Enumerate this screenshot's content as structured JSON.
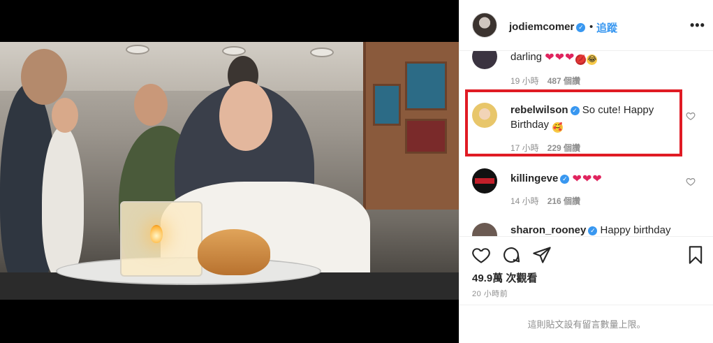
{
  "post": {
    "username": "jodiemcomer",
    "follow_label": "追蹤",
    "separator": "•",
    "more_label": "•••"
  },
  "comments": [
    {
      "text": "darling",
      "emoji_note": "❤❤❤",
      "time": "19 小時",
      "likes": "487 個讚"
    },
    {
      "username": "rebelwilson",
      "text": "So cute! Happy Birthday",
      "time": "17 小時",
      "likes": "229 個讚"
    },
    {
      "username": "killingeve",
      "text": "❤❤❤",
      "time": "14 小時",
      "likes": "216 個讚"
    },
    {
      "username": "sharon_rooney",
      "text": "Happy birthday"
    }
  ],
  "stats": {
    "views": "49.9萬 次觀看",
    "posted": "20 小時前"
  },
  "comments_disabled": "這則貼文設有留言數量上限。",
  "colors": {
    "accent": "#3897f0",
    "highlight": "#e01b24",
    "heart": "#e0245e",
    "muted": "#8e8e8e"
  },
  "icons": [
    "heart-icon",
    "comment-icon",
    "share-icon",
    "bookmark-icon",
    "verified-badge-icon",
    "more-options-icon"
  ]
}
